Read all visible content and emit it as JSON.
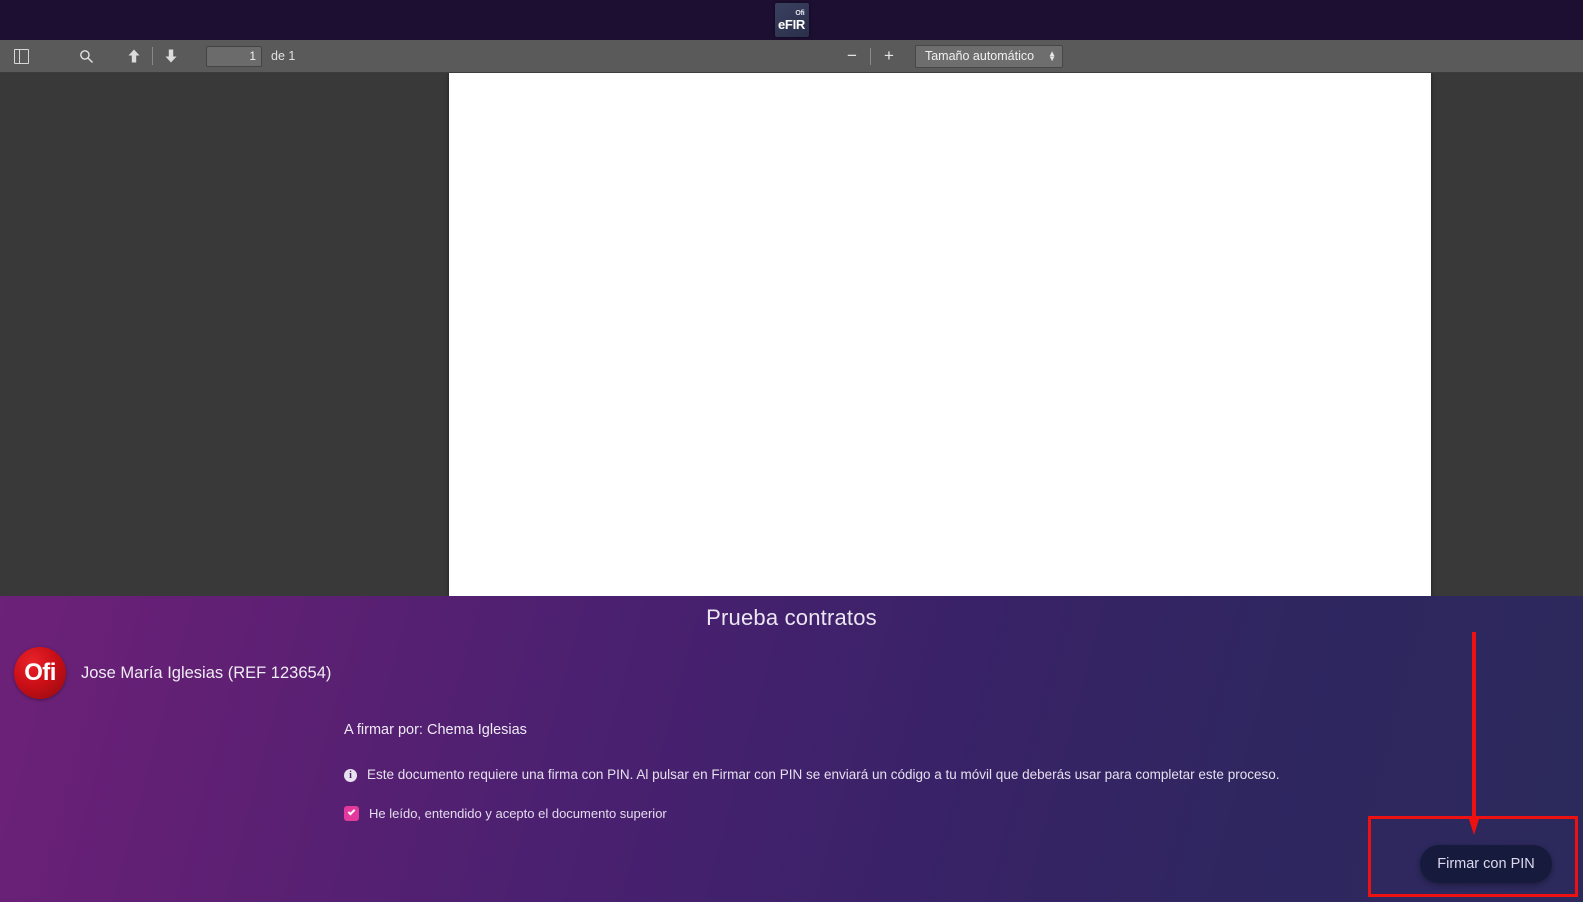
{
  "app": {
    "logo_sup": "Ofi",
    "logo_main": "eFIR"
  },
  "pdf_toolbar": {
    "sidebar_toggle_name": "sidebar-toggle",
    "search_label": "⌕",
    "prev_page_label": "↑",
    "next_page_label": "↓",
    "page_number": "1",
    "page_total": "de 1",
    "zoom_out_label": "−",
    "zoom_in_label": "+",
    "scale_value": "Tamaño automático",
    "stepper_up": "▲",
    "stepper_down": "▼"
  },
  "document": {
    "faint_lines": [
      "··················",
      "········",
      "························",
      "··········"
    ]
  },
  "sign_panel": {
    "title": "Prueba contratos",
    "badge_text": "Ofi",
    "signer_name": "Jose María Iglesias (REF 123654)",
    "sign_to": "A firmar por: Chema Iglesias",
    "info_icon_glyph": "i",
    "notice": "Este documento requiere una firma con PIN. Al pulsar en Firmar con PIN se enviará un código a tu móvil que deberás usar para completar este proceso.",
    "accept_label": "He leído, entendido y acepto el documento superior",
    "accept_checked": true,
    "sign_button_label": "Firmar con PIN"
  },
  "annotation": {
    "color": "#ee1111",
    "rect_name": "highlight-rectangle",
    "arrow_name": "pointer-arrow"
  },
  "colors": {
    "titlebar": "#1d0f31",
    "toolbar": "#5a5a5a",
    "viewer_bg": "#393939",
    "panel_left": "#6d2178",
    "panel_right": "#2c2a5c",
    "checkbox": "#e3389c",
    "sign_button": "#161a3c",
    "badge": "#cc0f17"
  }
}
